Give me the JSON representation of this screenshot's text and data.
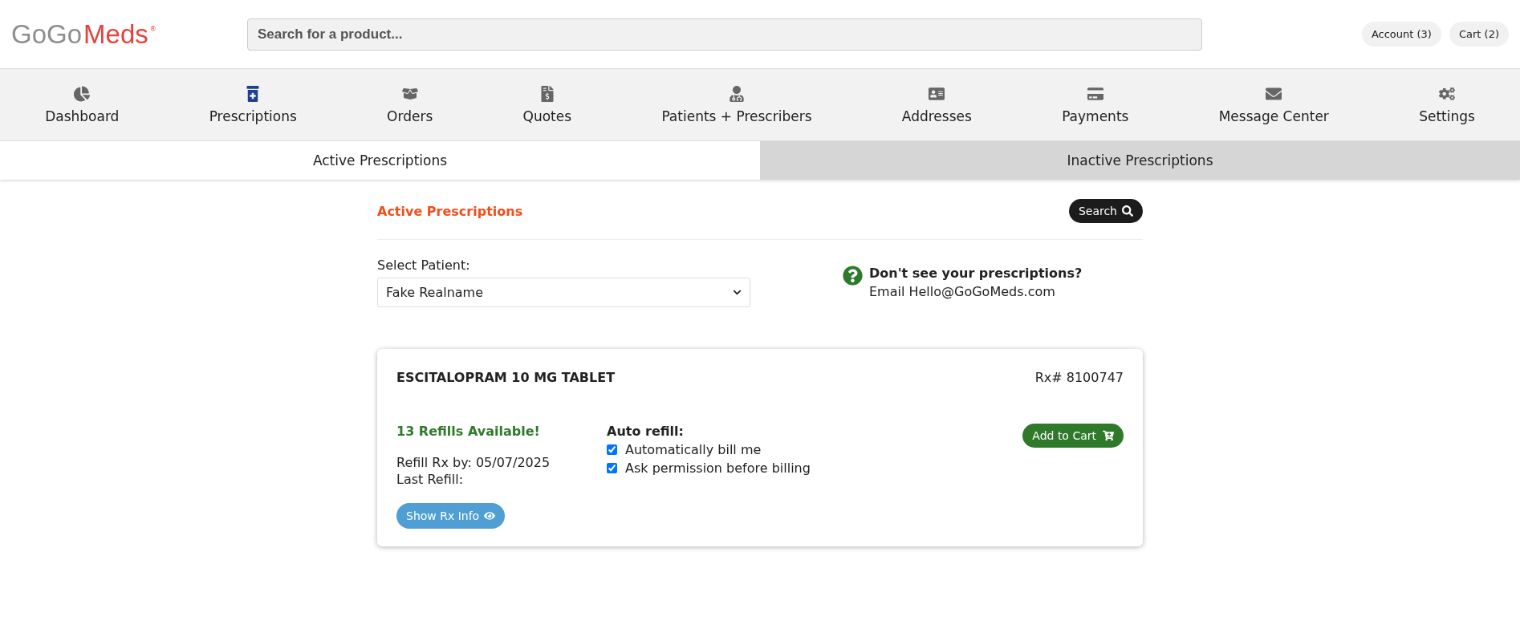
{
  "header": {
    "logo": {
      "part_1": "GoGo",
      "part_2": "Meds",
      "mark": "®"
    },
    "search": {
      "placeholder": "Search for a product..."
    },
    "buttons": [
      "Account (3)",
      "Cart (2)"
    ]
  },
  "nav": [
    {
      "label": "Dashboard",
      "selected": false
    },
    {
      "label": "Prescriptions",
      "selected": true
    },
    {
      "label": "Orders",
      "selected": false
    },
    {
      "label": "Quotes",
      "selected": false
    },
    {
      "label": "Patients + Prescribers",
      "selected": false
    },
    {
      "label": "Addresses",
      "selected": false
    },
    {
      "label": "Payments",
      "selected": false
    },
    {
      "label": "Message Center",
      "selected": false
    },
    {
      "label": "Settings",
      "selected": false
    }
  ],
  "tabs": [
    {
      "label": "Active Prescriptions",
      "selected": true
    },
    {
      "label": "Inactive Prescriptions",
      "selected": false
    }
  ],
  "section": {
    "title": "Active Prescriptions",
    "search_button": "Search"
  },
  "patient": {
    "label": "Select Patient:",
    "value": "Fake Realname"
  },
  "help": {
    "title": "Don't see your prescriptions?",
    "text": "Email Hello@GoGoMeds.com"
  },
  "prescriptions": [
    {
      "name": "ESCITALOPRAM 10 MG TABLET",
      "rx": "Rx# 8100747",
      "refills": "13 Refills Available!",
      "refill_by": "Refill Rx by: 05/07/2025",
      "last_refill": "Last Refill:",
      "info_button": "Show Rx Info",
      "auto_refill_label": "Auto refill:",
      "options": [
        {
          "label": "Automatically bill me",
          "checked": true
        },
        {
          "label": "Ask permission before billing",
          "checked": true
        }
      ],
      "cart_button": "Add to Cart"
    }
  ]
}
